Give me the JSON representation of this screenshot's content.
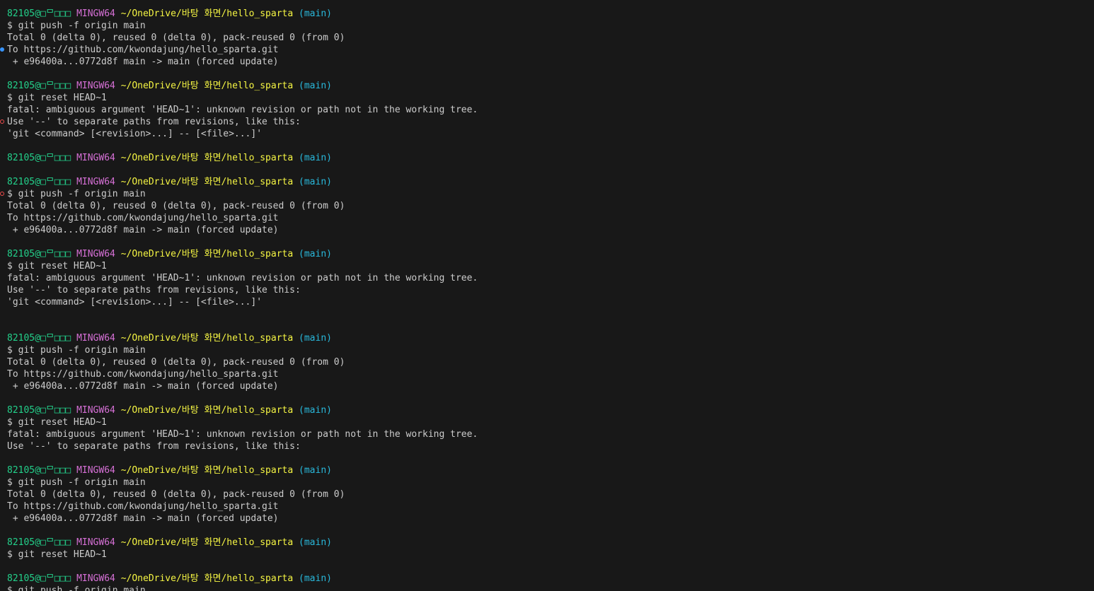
{
  "prompt": {
    "user": "82105@□ᄆ□□□",
    "host": "MINGW64",
    "path": "~/OneDrive/바탕 화면/hello_sparta",
    "branch": "(main)"
  },
  "lines": {
    "l1": "$ git push -f origin main",
    "l2": "Total 0 (delta 0), reused 0 (delta 0), pack-reused 0 (from 0)",
    "l3": "To https://github.com/kwondajung/hello_sparta.git",
    "l4": " + e96400a...0772d8f main -> main (forced update)",
    "l5": "$ git reset HEAD~1",
    "l6": "fatal: ambiguous argument 'HEAD~1': unknown revision or path not in the working tree.",
    "l7": "Use '--' to separate paths from revisions, like this:",
    "l8": "'git <command> [<revision>...] -- [<file>...]'",
    "l9": "$ git push -f origin main",
    "l10": "Total 0 (delta 0), reused 0 (delta 0), pack-reused 0 (from 0)",
    "l11": "To https://github.com/kwondajung/hello_sparta.git",
    "l12": " + e96400a...0772d8f main -> main (forced update)",
    "l13": "$ git reset HEAD~1",
    "l14": "fatal: ambiguous argument 'HEAD~1': unknown revision or path not in the working tree.",
    "l15": "Use '--' to separate paths from revisions, like this:",
    "l16": "'git <command> [<revision>...] -- [<file>...]'",
    "l17": "$ git push -f origin main",
    "l18": "Total 0 (delta 0), reused 0 (delta 0), pack-reused 0 (from 0)",
    "l19": "To https://github.com/kwondajung/hello_sparta.git",
    "l20": " + e96400a...0772d8f main -> main (forced update)",
    "l21": "$ git reset HEAD~1",
    "l22": "fatal: ambiguous argument 'HEAD~1': unknown revision or path not in the working tree.",
    "l23": "Use '--' to separate paths from revisions, like this:",
    "l24": "$ git push -f origin main",
    "l25": "Total 0 (delta 0), reused 0 (delta 0), pack-reused 0 (from 0)",
    "l26": "To https://github.com/kwondajung/hello_sparta.git",
    "l27": " + e96400a...0772d8f main -> main (forced update)",
    "l28": "$ git reset HEAD~1",
    "l29": "$ git push -f origin main"
  },
  "colors": {
    "background": "#181818",
    "user": "#23d18b",
    "host": "#d670d6",
    "path": "#f5f543",
    "branch": "#29b8db",
    "success_marker": "#3794ff",
    "error_marker": "#f14c4c"
  },
  "icons": {
    "success_marker": "command-success-dot-icon",
    "error_marker": "command-error-circle-icon"
  }
}
